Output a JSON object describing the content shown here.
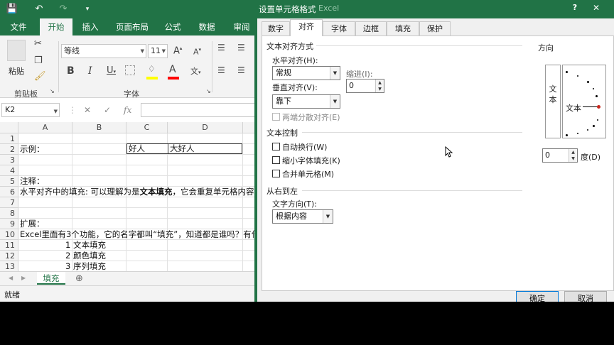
{
  "app": {
    "ribbon_tabs": [
      "文件",
      "开始",
      "插入",
      "页面布局",
      "公式",
      "数据",
      "审阅"
    ],
    "active_tab_index": 1,
    "font_name": "等线",
    "font_size": "11",
    "group_clipboard": "剪贴板",
    "group_font": "字体",
    "paste_label": "粘贴",
    "font_color": "#ff0000",
    "fill_color": "#ffff00",
    "accent": "#217346",
    "name_box": "K2",
    "fx_symbol": "fx",
    "columns": [
      "A",
      "B",
      "C",
      "D"
    ],
    "rows": [
      "1",
      "2",
      "3",
      "4",
      "5",
      "6",
      "7",
      "8",
      "9",
      "10",
      "11",
      "12",
      "13"
    ],
    "cells": {
      "a2": "示例：",
      "c2": "好人",
      "d2": "大好人",
      "a5": "注释：",
      "a6_pre": "水平对齐中的填充: 可以理解为是",
      "a6_bold": "文本填充",
      "a6_post": "，它会重复单元格内容",
      "a9": "扩展：",
      "a10": "Excel里面有3个功能，它的名字都叫“填充”，知道都是谁吗？有什",
      "a11": "1 文本填充",
      "a12": "2 颜色填充",
      "a13": "3 序列填充"
    },
    "sheet_tab": "填充",
    "status": "就绪"
  },
  "dialog": {
    "title": "设置单元格格式",
    "title_ghost": "Excel",
    "help": "?",
    "close": "✕",
    "tabs": [
      "数字",
      "对齐",
      "字体",
      "边框",
      "填充",
      "保护"
    ],
    "active_tab_index": 1,
    "text_align_section": "文本对齐方式",
    "horizontal_label": "水平对齐(H):",
    "horizontal_value": "常规",
    "indent_label": "缩进(I):",
    "indent_value": "0",
    "vertical_label": "垂直对齐(V):",
    "vertical_value": "靠下",
    "distributed_label": "两端分散对齐(E)",
    "text_control_section": "文本控制",
    "wrap_label": "自动换行(W)",
    "shrink_label": "缩小字体填充(K)",
    "merge_label": "合并单元格(M)",
    "rtl_section": "从右到左",
    "text_direction_label": "文字方向(T):",
    "text_direction_value": "根据内容",
    "orientation_title": "方向",
    "orientation_vertical_text": "文本",
    "orientation_dial_text": "文本",
    "degree_value": "0",
    "degree_label": "度(D)",
    "ok": "确定",
    "cancel": "取消"
  }
}
